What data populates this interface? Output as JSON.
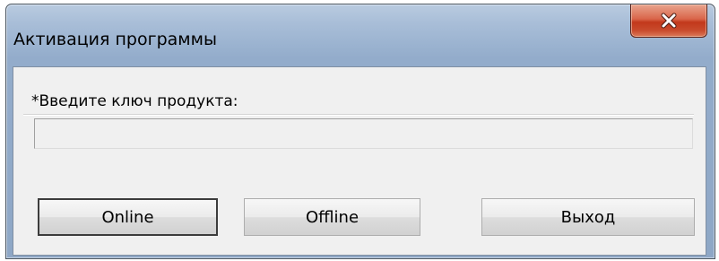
{
  "window": {
    "title": "Активация программы"
  },
  "icons": {
    "close": "close-icon"
  },
  "form": {
    "key_label": "*Введите ключ продукта:",
    "key_value": "",
    "key_placeholder": ""
  },
  "buttons": {
    "online": "Online",
    "offline": "Offline",
    "exit": "Выход"
  },
  "colors": {
    "title_bar": "#9bb3d0",
    "close_button": "#c2391c",
    "client_background": "#f0f0f0"
  }
}
